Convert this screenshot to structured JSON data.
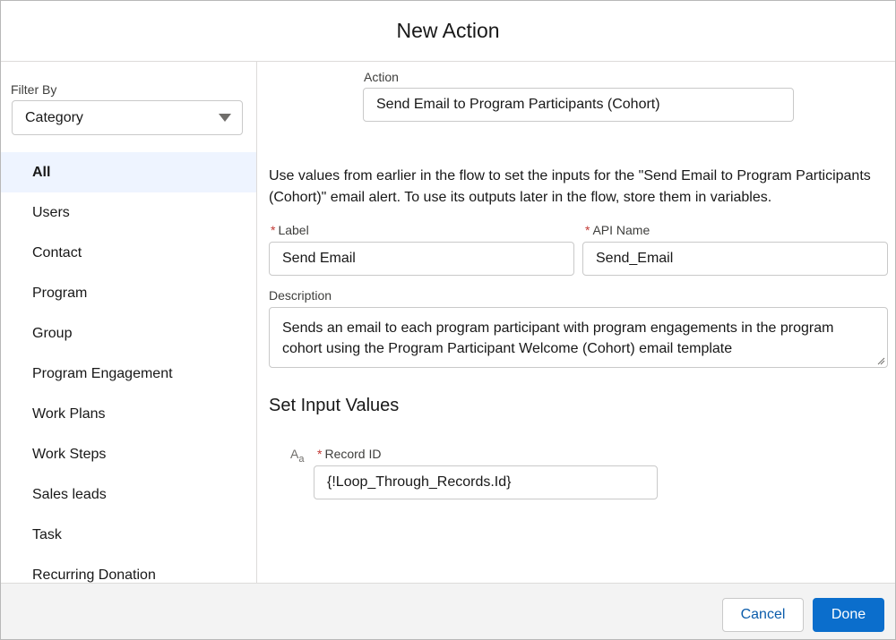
{
  "modal": {
    "title": "New Action"
  },
  "sidebar": {
    "filter_label": "Filter By",
    "filter_value": "Category",
    "items": [
      {
        "label": "All",
        "active": true
      },
      {
        "label": "Users"
      },
      {
        "label": "Contact"
      },
      {
        "label": "Program"
      },
      {
        "label": "Group"
      },
      {
        "label": "Program Engagement"
      },
      {
        "label": "Work Plans"
      },
      {
        "label": "Work Steps"
      },
      {
        "label": "Sales leads"
      },
      {
        "label": "Task"
      },
      {
        "label": "Recurring Donation"
      }
    ]
  },
  "main": {
    "action_label": "Action",
    "action_value": "Send Email to Program Participants (Cohort)",
    "description_text": "Use values from earlier in the flow to set the inputs for the \"Send Email to Program Participants (Cohort)\" email alert. To use its outputs later in the flow, store them in variables.",
    "required_marker": "*",
    "label_field": {
      "label": "Label",
      "value": "Send Email"
    },
    "api_name_field": {
      "label": "API Name",
      "value": "Send_Email"
    },
    "description_field": {
      "label": "Description",
      "value": "Sends an email to each program participant with program engagements in the program cohort using the Program Participant Welcome (Cohort) email template"
    },
    "section_title": "Set Input Values",
    "type_icon": {
      "big": "A",
      "small": "a",
      "name": "text-type-icon"
    },
    "record_id": {
      "label": "Record ID",
      "value": "{!Loop_Through_Records.Id}"
    }
  },
  "footer": {
    "cancel_label": "Cancel",
    "done_label": "Done"
  },
  "colors": {
    "brand": "#0b6ecc",
    "active_bg": "#eef4ff",
    "required": "#c23934"
  }
}
